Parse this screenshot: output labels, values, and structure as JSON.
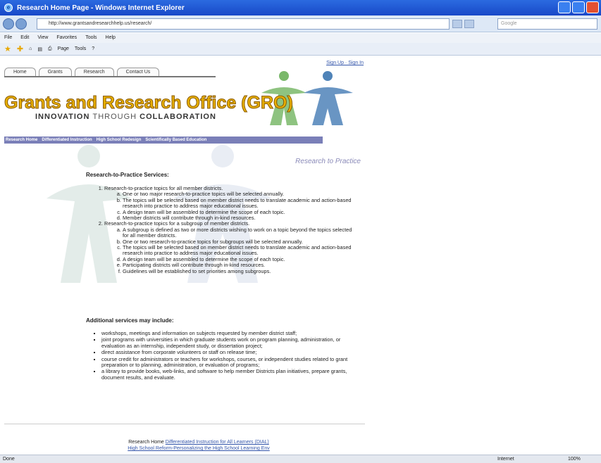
{
  "window": {
    "title": "Research Home Page - Windows Internet Explorer"
  },
  "address": {
    "url": "http://www.grantsandresearchhelp.us/research/",
    "search_placeholder": "Google"
  },
  "menu": [
    "File",
    "Edit",
    "View",
    "Favorites",
    "Tools",
    "Help"
  ],
  "toolbar": {
    "page_label": "Page",
    "tools_label": "Tools"
  },
  "site": {
    "signin": "Sign Up · Sign In",
    "tabs": [
      "Home",
      "Grants",
      "Research",
      "Contact Us"
    ],
    "title": "Grants and Research Office (GRO)",
    "tagline_a": "INNOVATION",
    "tagline_b": "THROUGH",
    "tagline_c": "COLLABORATION",
    "subnav": [
      "Research Home",
      "Differentiated Instruction",
      "High School Redesign",
      "Scientifically Based Education"
    ],
    "section_tag": "Research to Practice"
  },
  "services": {
    "heading": "Research-to-Practice Services:",
    "items": [
      {
        "text": "Research-to-practice topics for all member districts.",
        "sub": [
          "One or two major research-to-practice topics will be selected annually.",
          "The topics will be selected based on member district needs to translate academic and action-based research into practice to address major educational issues.",
          "A design team will be assembled to determine the scope of each topic.",
          "Member districts will contribute through in-kind resources."
        ]
      },
      {
        "text": "Research-to-practice topics for a subgroup of member districts.",
        "sub": [
          "A subgroup is defined as two or more districts wishing to work on a topic beyond the topics selected for all member districts.",
          "One or two research-to-practice topics for subgroups will be selected annually.",
          "The topics will be selected based on member district needs to translate academic and action-based research into practice to address major educational issues.",
          "A design team will be assembled to determine the scope of each topic.",
          "Participating districts will contribute through in-kind resources.",
          "Guidelines will be established to set priorities among subgroups."
        ]
      }
    ]
  },
  "additional": {
    "heading": "Additional services may include:",
    "items": [
      "workshops, meetings and information on subjects requested by member district staff;",
      "joint programs with universities in which graduate students work on program planning, administration, or evaluation as an internship, independent study, or dissertation project;",
      "direct assistance from corporate volunteers or staff on release time;",
      "course credit for administrators or teachers for workshops, courses, or independent studies related to grant preparation or to planning, administration, or evaluation of programs;",
      "a library to provide books, web-links, and software to help member Districts plan initiatives, prepare grants, document results, and evaluate."
    ]
  },
  "footer": {
    "home": "Research Home",
    "link1": "Differentiated Instruction for All Learners (DIAL)",
    "link2": "High School Reform-Personalizing the High School Learning Env"
  },
  "status": {
    "left": "Done",
    "zone": "Internet",
    "zoom": "100%"
  }
}
